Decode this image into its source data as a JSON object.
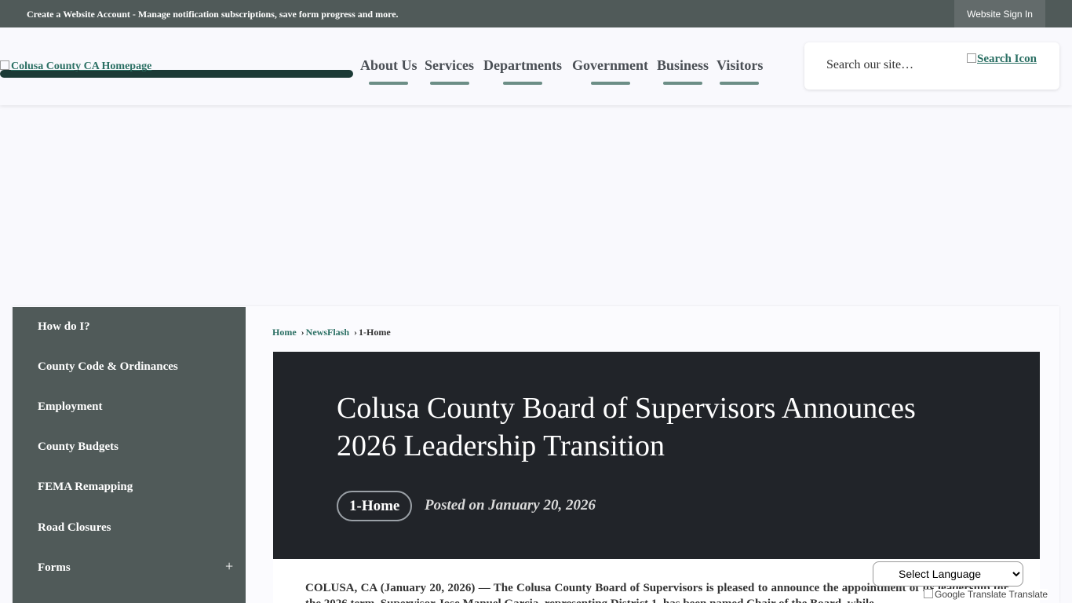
{
  "topbar": {
    "message": "Create a Website Account - Manage notification subscriptions, save form progress and more.",
    "signin_label": "Website Sign In"
  },
  "header": {
    "logo_alt": "Colusa County CA Homepage",
    "nav": [
      {
        "label": "About Us"
      },
      {
        "label": "Services"
      },
      {
        "label": "Departments"
      },
      {
        "label": "Government"
      },
      {
        "label": "Business"
      },
      {
        "label": "Visitors"
      }
    ],
    "search": {
      "placeholder": "Search our site…",
      "icon_alt": "Search Icon",
      "icon": "search-icon"
    }
  },
  "sidebar": {
    "items": [
      {
        "label": "How do I?"
      },
      {
        "label": "County Code & Ordinances"
      },
      {
        "label": "Employment"
      },
      {
        "label": "County Budgets"
      },
      {
        "label": "FEMA Remapping"
      },
      {
        "label": "Road Closures"
      },
      {
        "label": "Forms",
        "expand": "+"
      }
    ]
  },
  "breadcrumb": {
    "home": "Home",
    "newsflash": "NewsFlash",
    "current": "1-Home",
    "separator": "›"
  },
  "article": {
    "title": "Colusa County Board of Supervisors Announces 2026 Leadership Transition",
    "tag": "1-Home",
    "posted": "Posted on January 20, 2026",
    "body": "COLUSA, CA (January 20, 2026) — The Colusa County Board of Supervisors is pleased to announce the appointment of its leadership for the 2026 term. Supervisor Jose Manuel Garcia, representing District 1, has been named Chair of the Board, while"
  },
  "translate": {
    "select_label": "Select Language",
    "attribution": "Google Translate Translate"
  },
  "colors": {
    "topbar": "#505a59",
    "accent": "#2a6f63",
    "hero": "#212429"
  }
}
